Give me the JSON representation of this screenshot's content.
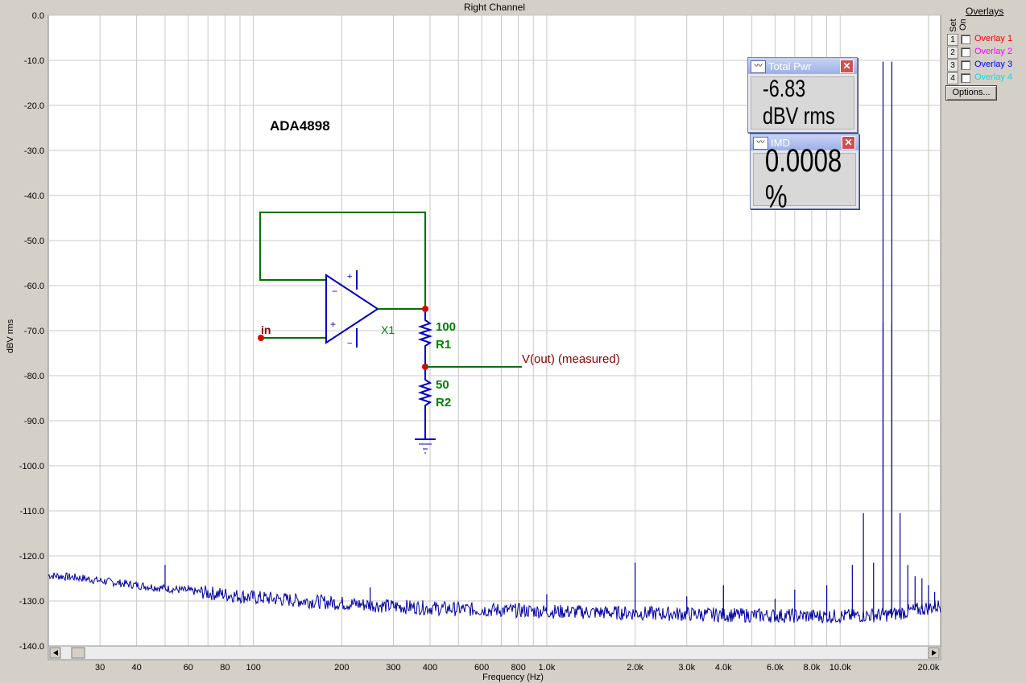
{
  "title": "Right Channel",
  "overlays": {
    "title": "Overlays",
    "col_set": "Set",
    "col_on": "On",
    "items": [
      {
        "num": "1",
        "label": "Overlay 1",
        "color": "#ff0000"
      },
      {
        "num": "2",
        "label": "Overlay 2",
        "color": "#ff00ff"
      },
      {
        "num": "3",
        "label": "Overlay 3",
        "color": "#0000ff"
      },
      {
        "num": "4",
        "label": "Overlay 4",
        "color": "#00e0e0"
      }
    ],
    "options_label": "Options..."
  },
  "meters": {
    "total_pwr": {
      "title": "Total Pwr",
      "value": "-6.83 dBV rms"
    },
    "imd": {
      "title": "IMD",
      "value": "0.0008 %"
    }
  },
  "schematic": {
    "chip": "ADA4898",
    "in_label": "in",
    "x1_label": "X1",
    "r1_value": "100",
    "r1_label": "R1",
    "r2_value": "50",
    "r2_label": "R2",
    "vout_label": "V(out)  (measured)",
    "plus": "+",
    "minus": "−"
  },
  "chart_data": {
    "type": "line",
    "title": "Right Channel",
    "xlabel": "Frequency (Hz)",
    "ylabel": "dBV rms",
    "x_scale": "log",
    "xlim": [
      20,
      22000
    ],
    "ylim": [
      -140,
      0
    ],
    "grid": true,
    "y_ticks": [
      "0.0",
      "-10.0",
      "-20.0",
      "-30.0",
      "-40.0",
      "-50.0",
      "-60.0",
      "-70.0",
      "-80.0",
      "-90.0",
      "-100.0",
      "-110.0",
      "-120.0",
      "-130.0",
      "-140.0"
    ],
    "y_tick_values": [
      0,
      -10,
      -20,
      -30,
      -40,
      -50,
      -60,
      -70,
      -80,
      -90,
      -100,
      -110,
      -120,
      -130,
      -140
    ],
    "x_tick_labels": [
      "30",
      "40",
      "60",
      "80",
      "100",
      "200",
      "300",
      "400",
      "600",
      "800",
      "1.0k",
      "2.0k",
      "3.0k",
      "4.0k",
      "6.0k",
      "8.0k",
      "10.0k",
      "20.0k"
    ],
    "x_tick_values": [
      30,
      40,
      60,
      80,
      100,
      200,
      300,
      400,
      600,
      800,
      1000,
      2000,
      3000,
      4000,
      6000,
      8000,
      10000,
      20000
    ],
    "series_color": "#0000a0",
    "noise_floor": [
      [
        20,
        -124.3
      ],
      [
        25,
        -124.8
      ],
      [
        30,
        -125.5
      ],
      [
        40,
        -126.5
      ],
      [
        50,
        -127.2
      ],
      [
        70,
        -128.2
      ],
      [
        100,
        -129.2
      ],
      [
        150,
        -130.0
      ],
      [
        200,
        -130.5
      ],
      [
        300,
        -131.2
      ],
      [
        500,
        -131.8
      ],
      [
        1000,
        -132.3
      ],
      [
        2000,
        -132.7
      ],
      [
        5000,
        -133.2
      ],
      [
        10000,
        -133.4
      ],
      [
        15000,
        -133.0
      ],
      [
        22000,
        -131.0
      ]
    ],
    "peaks": [
      [
        50,
        -122.0
      ],
      [
        60,
        -126.5
      ],
      [
        250,
        -127.0
      ],
      [
        1000,
        -128.5
      ],
      [
        2000,
        -121.5
      ],
      [
        3000,
        -129.0
      ],
      [
        4000,
        -126.5
      ],
      [
        6000,
        -129.5
      ],
      [
        7000,
        -127.5
      ],
      [
        9000,
        -126.5
      ],
      [
        11000,
        -122.0
      ],
      [
        12000,
        -110.5
      ],
      [
        13000,
        -121.5
      ],
      [
        14000,
        -10.3
      ],
      [
        14000,
        -68.3
      ],
      [
        15000,
        -10.3
      ],
      [
        15000,
        -68.3
      ],
      [
        16000,
        -110.5
      ],
      [
        17000,
        -122.0
      ],
      [
        18000,
        -124.5
      ],
      [
        19000,
        -125.0
      ],
      [
        20000,
        -126.5
      ],
      [
        21000,
        -128.0
      ]
    ]
  }
}
